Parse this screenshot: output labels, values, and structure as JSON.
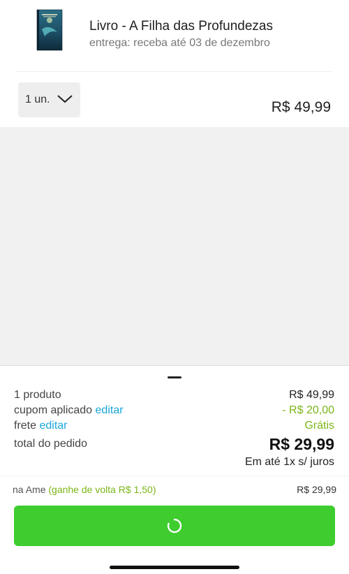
{
  "product": {
    "title": "Livro - A Filha das Profundezas",
    "delivery": "entrega: receba até 03 de dezembro",
    "quantity": "1 un.",
    "price": "R$ 49,99"
  },
  "summary": {
    "products_label": "1 produto",
    "products_value": "R$ 49,99",
    "coupon_label": "cupom aplicado",
    "coupon_edit": "editar",
    "coupon_value": "- R$ 20,00",
    "shipping_label": "frete",
    "shipping_edit": "editar",
    "shipping_value": "Grátis",
    "total_label": "total do pedido",
    "total_value": "R$ 29,99",
    "installments": "Em até 1x s/ juros"
  },
  "ame": {
    "label": "na Ame",
    "cashback": "(ganhe de volta R$ 1,50)",
    "price": "R$ 29,99"
  },
  "colors": {
    "accent_green": "#3ecc2f",
    "discount_green": "#7cb518",
    "link_blue": "#1aa6d8"
  }
}
